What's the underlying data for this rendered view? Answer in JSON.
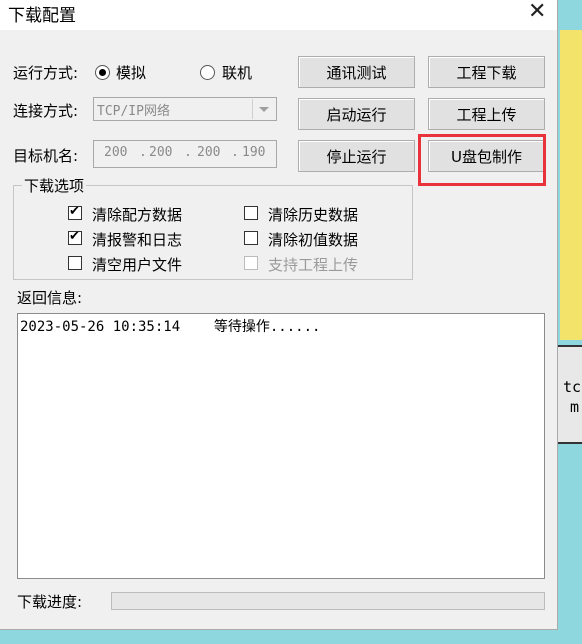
{
  "window": {
    "title": "下载配置"
  },
  "run_mode": {
    "label": "运行方式:",
    "options": [
      "模拟",
      "联机"
    ],
    "selected": "模拟"
  },
  "connection": {
    "label": "连接方式:",
    "value": "TCP/IP网络"
  },
  "target": {
    "label": "目标机名:",
    "ip": [
      "200",
      "200",
      "200",
      "190"
    ],
    "sep": "."
  },
  "buttons": {
    "comm_test": "通讯测试",
    "project_download": "工程下载",
    "start_run": "启动运行",
    "project_upload": "工程上传",
    "stop_run": "停止运行",
    "usb_make": "U盘包制作"
  },
  "download_options": {
    "title": "下载选项",
    "items": [
      {
        "label": "清除配方数据",
        "checked": true,
        "enabled": true
      },
      {
        "label": "清除历史数据",
        "checked": false,
        "enabled": true
      },
      {
        "label": "清报警和日志",
        "checked": true,
        "enabled": true
      },
      {
        "label": "清除初值数据",
        "checked": false,
        "enabled": true
      },
      {
        "label": "清空用户文件",
        "checked": false,
        "enabled": true
      },
      {
        "label": "支持工程上传",
        "checked": false,
        "enabled": false
      }
    ]
  },
  "feedback": {
    "label": "返回信息:",
    "lines": [
      "2023-05-26 10:35:14    等待操作......"
    ]
  },
  "progress": {
    "label": "下载进度:",
    "value": 0
  },
  "background": {
    "line1": "tc",
    "line2": "m"
  },
  "colors": {
    "highlight": "#e8323c",
    "dialog_bg": "#f0f0f0",
    "desktop_bg": "#8fd7df"
  }
}
